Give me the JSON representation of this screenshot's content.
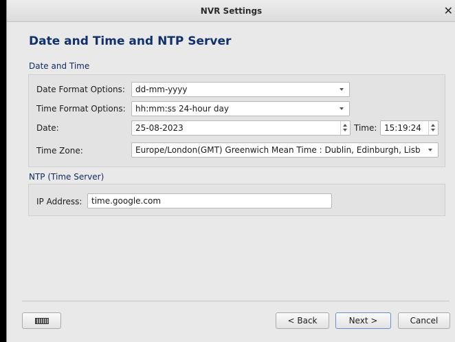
{
  "window": {
    "title": "NVR Settings",
    "close_glyph": "✕"
  },
  "page": {
    "title": "Date and Time and NTP Server"
  },
  "date_time": {
    "section_label": "Date and Time",
    "date_format": {
      "label": "Date Format Options:",
      "value": "dd-mm-yyyy"
    },
    "time_format": {
      "label": "Time Format Options:",
      "value": "hh:mm:ss 24-hour day"
    },
    "date": {
      "label": "Date:",
      "value": "25-08-2023"
    },
    "time": {
      "label": "Time:",
      "value": "15:19:24"
    },
    "time_zone": {
      "label": "Time Zone:",
      "value": "Europe/London(GMT) Greenwich Mean Time : Dublin, Edinburgh, Lisb"
    }
  },
  "ntp": {
    "section_label": "NTP (Time Server)",
    "ip_address": {
      "label": "IP Address:",
      "value": "time.google.com"
    }
  },
  "footer": {
    "keyboard_icon": "keyboard-icon",
    "back_label": "< Back",
    "next_label": "Next >",
    "cancel_label": "Cancel"
  }
}
